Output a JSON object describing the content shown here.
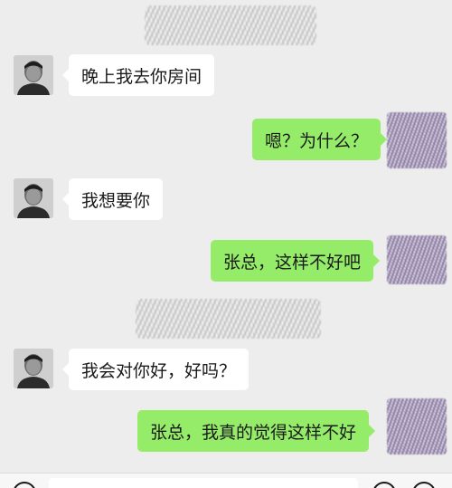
{
  "chat": {
    "messages": [
      {
        "side": "left",
        "text": "晚上我去你房间"
      },
      {
        "side": "right",
        "text": "嗯？为什么？"
      },
      {
        "side": "left",
        "text": "我想要你"
      },
      {
        "side": "right",
        "text": "张总，这样不好吧"
      },
      {
        "side": "left",
        "text": "我会对你好，好吗？"
      },
      {
        "side": "right",
        "text": "张总，我真的觉得这样不好"
      }
    ]
  },
  "icons": {
    "voice": "voice-icon",
    "emoji": "emoji-icon",
    "plus": "plus-icon"
  },
  "colors": {
    "background": "#ededed",
    "sent_bubble": "#95ec69",
    "received_bubble": "#ffffff",
    "text": "#1a1a1a"
  }
}
